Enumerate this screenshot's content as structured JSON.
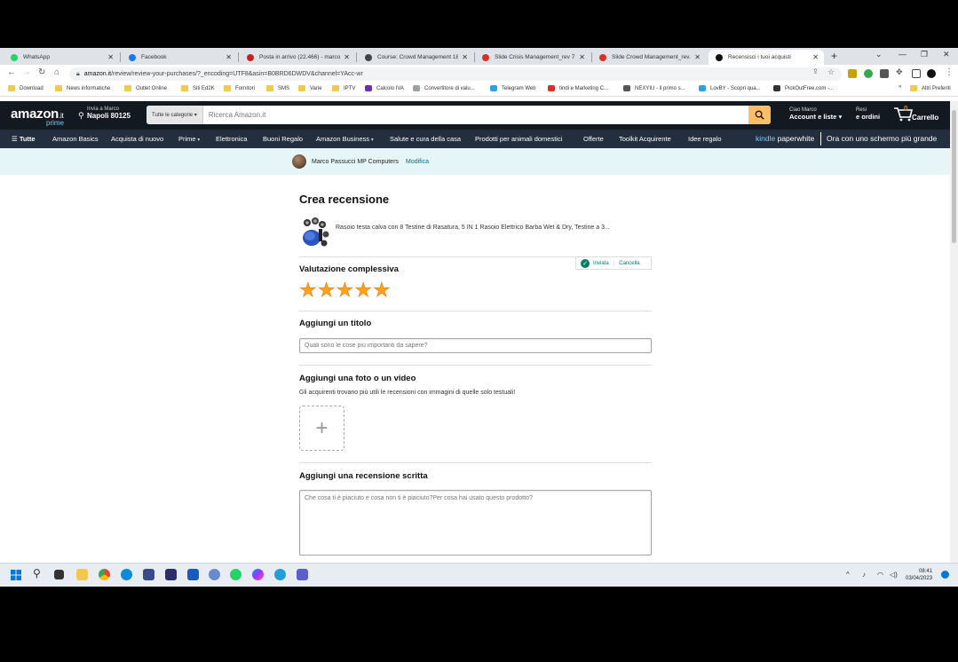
{
  "browser": {
    "tabs": [
      {
        "title": "WhatsApp",
        "color": "#25d366"
      },
      {
        "title": "Facebook",
        "color": "#1877f2"
      },
      {
        "title": "Posta in arrivo (22.466) - marco...",
        "color": "#c5221f"
      },
      {
        "title": "Course: Crowd Management 18...",
        "color": "#444"
      },
      {
        "title": "Slide Crisis Management_rev 7...",
        "color": "#d93025"
      },
      {
        "title": "Slide Crowd Management_rev...",
        "color": "#d93025"
      },
      {
        "title": "Recensisci i tuoi acquisti",
        "color": "#111"
      }
    ],
    "new_tab": "+",
    "url_domain": "amazon.it",
    "url_path": "/review/review-your-purchases/?_encoding=UTF8&asin=B0BRD6DWDV&channel=YAcc-wr",
    "bookmarks": [
      "Download",
      "News informatiche",
      "Outlet Online",
      "Siti Ed2K",
      "Fornitori",
      "SMS",
      "Varie",
      "IPTV",
      "Calcolo IVA",
      "Convertitore di valu...",
      "Telegram Web",
      "tindi e Marketing C...",
      "NEXYIU - il primo s...",
      "LovBY - Scopri qua...",
      "PickOutFree.com -..."
    ],
    "bookmarks_more": "»",
    "other_bookmarks": "Altri Preferiti"
  },
  "amazon": {
    "logo": "amazon",
    "logo_tld": ".it",
    "logo_prime": "prime",
    "deliver_to": "Invia a Marco",
    "deliver_loc": "Napoli 80125",
    "search_category": "Tutte le categorie",
    "search_placeholder": "Ricerca Amazon.it",
    "account_line1": "Ciao Marco",
    "account_line2": "Account e liste",
    "orders_line1": "Resi",
    "orders_line2": "e ordini",
    "cart_count": "0",
    "cart_label": "Carrello",
    "nav_all": "Tutte",
    "nav_items": [
      "Amazon Basics",
      "Acquista di nuovo",
      "Prime",
      "Elettronica",
      "Buoni Regalo",
      "Amazon Business",
      "Salute e cura della casa",
      "Prodotti per animali domestici",
      "Offerte",
      "Toolkit Acquirente",
      "Idee regalo"
    ],
    "kindle_a": "kindle",
    "kindle_b": "paperwhite",
    "kindle_promo": "Ora con uno schermo più grande",
    "profile_name": "Marco Passucci MP Computers",
    "profile_edit": "Modifica"
  },
  "review": {
    "heading": "Crea recensione",
    "product_title": "Rasoio testa calva con 8 Testine di Rasatura, 5 IN 1 Rasoio Elettrico Barba Wet & Dry, Testine a 3...",
    "overall_label": "Valutazione complessiva",
    "rating_stars": 5,
    "status_sent": "Inviata",
    "status_cancel": "Cancella",
    "title_label": "Aggiungi un titolo",
    "title_placeholder": "Quali sono le cose più importanti da sapere?",
    "media_label": "Aggiungi una foto o un video",
    "media_hint": "Gli acquirenti trovano più utili le recensioni con immagini di quelle solo testuali!",
    "upload_symbol": "+",
    "written_label": "Aggiungi una recensione scritta",
    "written_placeholder": "Che cosa ti è piaciuto e cosa non ti è piaciuto?Per cosa hai usato questo prodotto?"
  },
  "taskbar": {
    "time": "08:41",
    "date": "03/04/2023"
  }
}
